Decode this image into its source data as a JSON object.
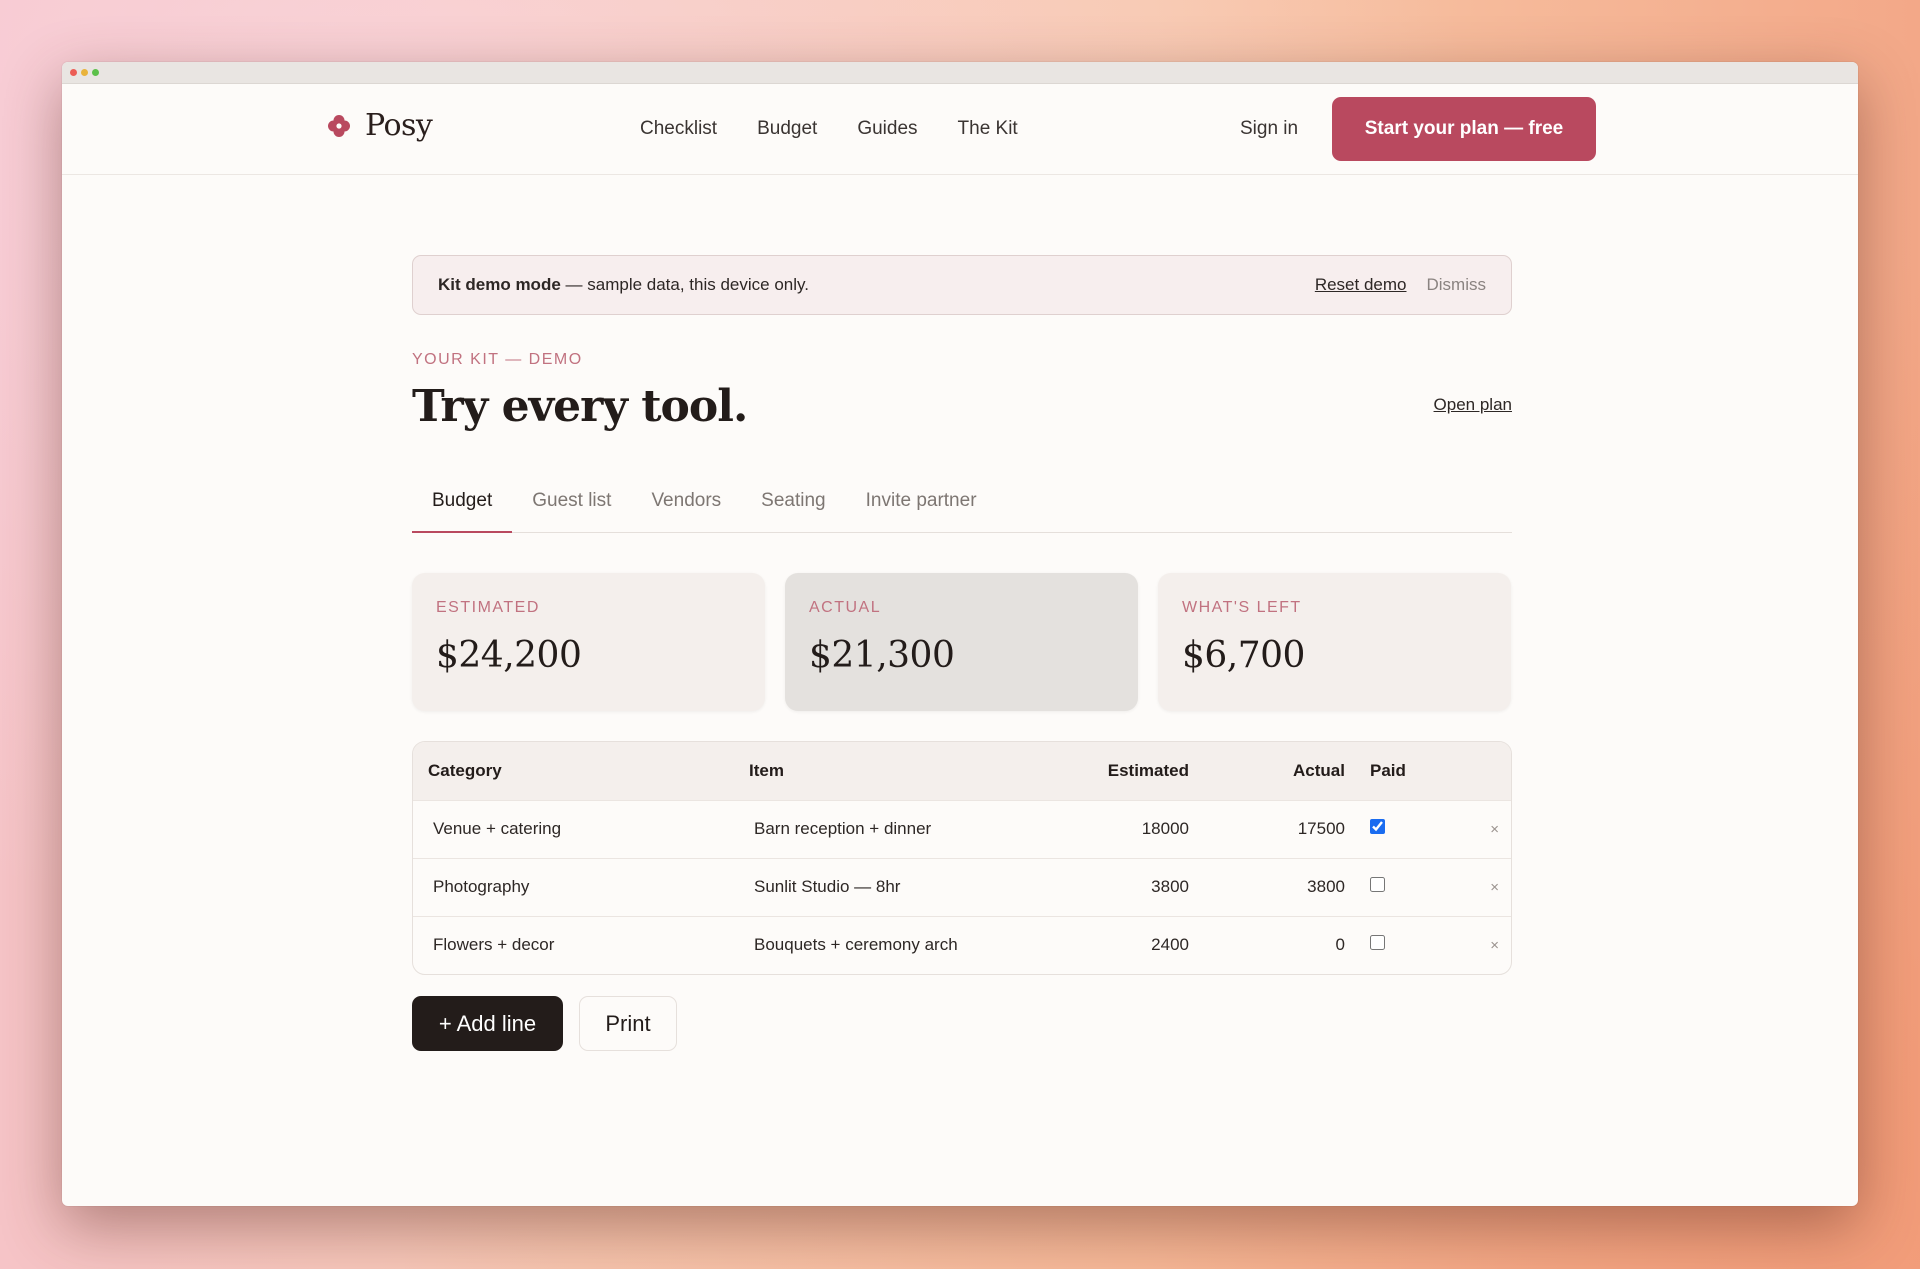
{
  "brand": {
    "name": "Posy",
    "accent": "#b9495f"
  },
  "nav": {
    "links": [
      "Checklist",
      "Budget",
      "Guides",
      "The Kit"
    ],
    "signin": "Sign in",
    "cta": "Start your plan — free"
  },
  "banner": {
    "bold": "Kit demo mode",
    "text": " — sample data, this device only.",
    "reset": "Reset demo",
    "dismiss": "Dismiss"
  },
  "page": {
    "eyebrow": "YOUR KIT — DEMO",
    "title": "Try every tool.",
    "open_plan": "Open plan"
  },
  "tabs": [
    "Budget",
    "Guest list",
    "Vendors",
    "Seating",
    "Invite partner"
  ],
  "active_tab": "Budget",
  "summary": [
    {
      "label": "ESTIMATED",
      "value": "$24,200"
    },
    {
      "label": "ACTUAL",
      "value": "$21,300"
    },
    {
      "label": "WHAT'S LEFT",
      "value": "$6,700"
    }
  ],
  "table": {
    "headers": {
      "category": "Category",
      "item": "Item",
      "estimated": "Estimated",
      "actual": "Actual",
      "paid": "Paid"
    },
    "rows": [
      {
        "category": "Venue + catering",
        "item": "Barn reception + dinner",
        "estimated": "18000",
        "actual": "17500",
        "paid": true
      },
      {
        "category": "Photography",
        "item": "Sunlit Studio — 8hr",
        "estimated": "3800",
        "actual": "3800",
        "paid": false
      },
      {
        "category": "Flowers + decor",
        "item": "Bouquets + ceremony arch",
        "estimated": "2400",
        "actual": "0",
        "paid": false
      }
    ],
    "remove_glyph": "×"
  },
  "actions": {
    "add": "+ Add line",
    "print": "Print"
  }
}
